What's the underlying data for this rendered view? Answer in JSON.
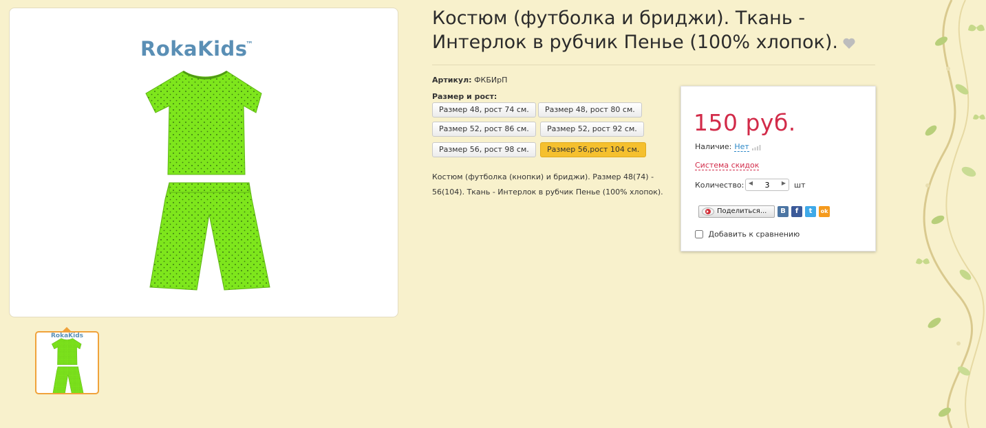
{
  "product": {
    "title": "Костюм (футболка и бриджи). Ткань - Интерлок в рубчик Пенье (100% хлопок).",
    "brand_logo": "RokaKids",
    "brand_logo_tm": "™",
    "thumbnail_logo": "RokaKids",
    "sku_label": "Артикул:",
    "sku_value": "ФКБИрП",
    "size_label": "Размер и рост:",
    "sizes": [
      {
        "label": "Размер 48, рост 74 см.",
        "selected": false
      },
      {
        "label": "Размер 48, рост 80 см.",
        "selected": false
      },
      {
        "label": "Размер 52, рост 86 см.",
        "selected": false
      },
      {
        "label": "Размер 52, рост 92 см.",
        "selected": false
      },
      {
        "label": "Размер 56, рост 98 см.",
        "selected": false
      },
      {
        "label": "Размер 56,рост 104 см.",
        "selected": true
      }
    ],
    "description": "Костюм (футболка (кнопки) и бриджи). Размер 48(74) - 56(104). Ткань - Интерлок в рубчик Пенье (100% хлопок)."
  },
  "buy_box": {
    "price": "150 руб.",
    "availability_label": "Наличие:",
    "availability_value": "Нет",
    "discount_link": "Система скидок",
    "quantity_label": "Количество:",
    "quantity_value": "3",
    "quantity_unit": "шт",
    "share_label": "Поделиться...",
    "social": [
      {
        "name": "vk",
        "glyph": "В"
      },
      {
        "name": "facebook",
        "glyph": "f"
      },
      {
        "name": "twitter",
        "glyph": "t"
      },
      {
        "name": "odnoklassniki",
        "glyph": "ok"
      }
    ],
    "compare_label": "Добавить к сравнению",
    "compare_checked": false
  },
  "colors": {
    "background": "#f8f1cc",
    "price": "#d22b49",
    "link": "#2a87c7",
    "selected_size": "#f5c02e",
    "thumbnail_border": "#f0a23a",
    "garment": "#7ee61c"
  },
  "icons": [
    "heart-icon",
    "signal-icon",
    "share-icon",
    "vk-icon",
    "facebook-icon",
    "twitter-icon",
    "odnoklassniki-icon",
    "decorative-vine"
  ]
}
